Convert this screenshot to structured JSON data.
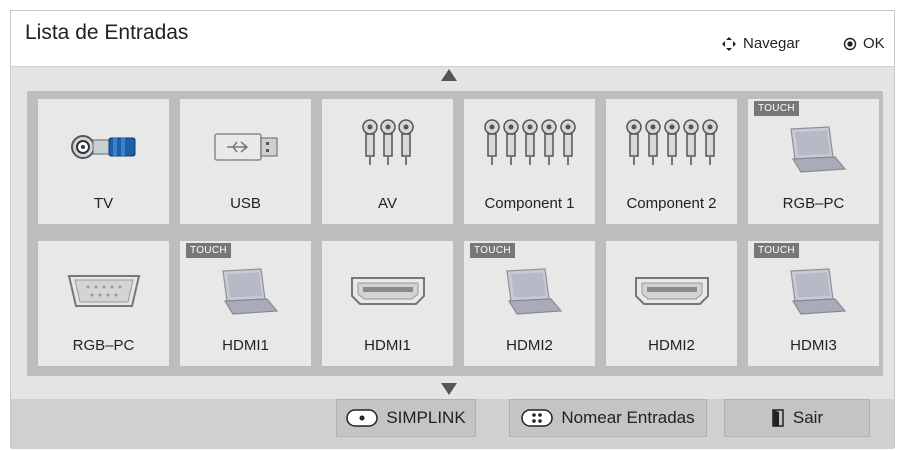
{
  "title": "Lista de Entradas",
  "hints": {
    "navigate": "Navegar",
    "ok": "OK"
  },
  "touch_badge": "TOUCH",
  "inputs_row1": [
    {
      "label": "TV",
      "icon": "coax-icon",
      "touch": false
    },
    {
      "label": "USB",
      "icon": "usb-icon",
      "touch": false
    },
    {
      "label": "AV",
      "icon": "rca-av-icon",
      "touch": false
    },
    {
      "label": "Component 1",
      "icon": "component-icon",
      "touch": false
    },
    {
      "label": "Component 2",
      "icon": "component-icon",
      "touch": false
    },
    {
      "label": "RGB–PC",
      "icon": "laptop-icon",
      "touch": true
    }
  ],
  "inputs_row2": [
    {
      "label": "RGB–PC",
      "icon": "vga-icon",
      "touch": false
    },
    {
      "label": "HDMI1",
      "icon": "laptop-icon",
      "touch": true
    },
    {
      "label": "HDMI1",
      "icon": "hdmi-icon",
      "touch": false
    },
    {
      "label": "HDMI2",
      "icon": "laptop-icon",
      "touch": true
    },
    {
      "label": "HDMI2",
      "icon": "hdmi-icon",
      "touch": false
    },
    {
      "label": "HDMI3",
      "icon": "laptop-icon",
      "touch": true
    }
  ],
  "buttons": {
    "simplink": "SIMPLINK",
    "rename": "Nomear Entradas",
    "exit": "Sair"
  }
}
